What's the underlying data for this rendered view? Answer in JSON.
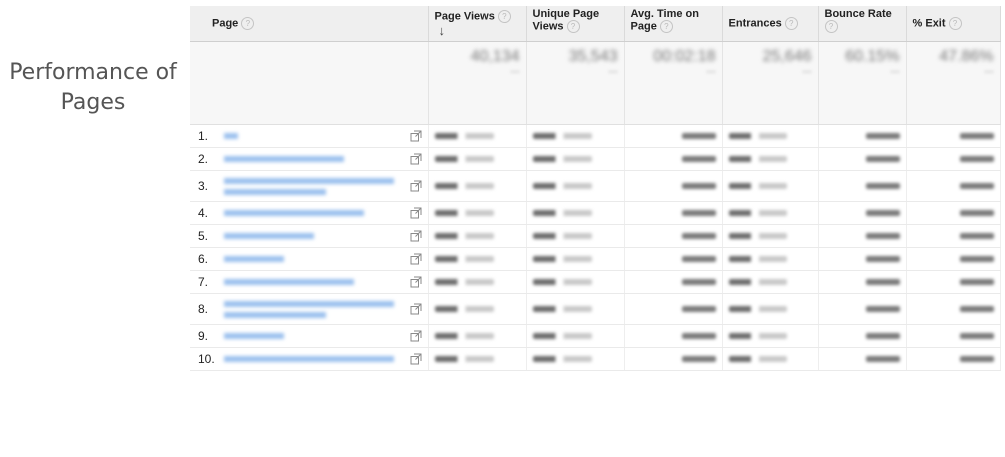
{
  "side_title": "Performance of Pages",
  "icons": {
    "help": "?",
    "external_link": "external-link-icon",
    "sort": "↓"
  },
  "columns": {
    "page": "Page",
    "page_views": "Page Views",
    "unique_page_views": "Unique Page Views",
    "avg_time": "Avg. Time on Page",
    "entrances": "Entrances",
    "bounce_rate": "Bounce Rate",
    "exit": "% Exit"
  },
  "totals": {
    "page_views": "40,134",
    "unique_page_views": "35,543",
    "avg_time": "00:02:18",
    "entrances": "25,646",
    "bounce_rate": "60.15%",
    "exit": "47.86%"
  },
  "rows": [
    {
      "index": "1."
    },
    {
      "index": "2."
    },
    {
      "index": "3."
    },
    {
      "index": "4."
    },
    {
      "index": "5."
    },
    {
      "index": "6."
    },
    {
      "index": "7."
    },
    {
      "index": "8."
    },
    {
      "index": "9."
    },
    {
      "index": "10."
    }
  ]
}
